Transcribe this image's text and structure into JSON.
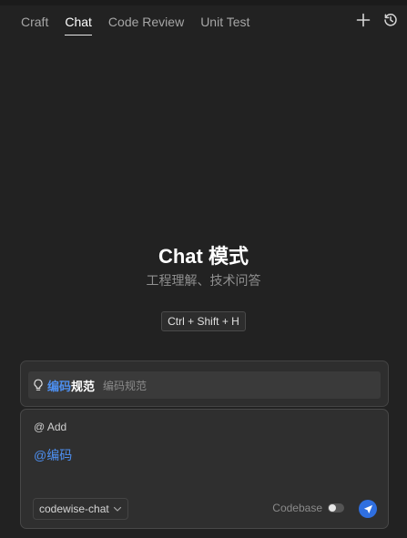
{
  "tabs": [
    {
      "label": "Craft",
      "active": false
    },
    {
      "label": "Chat",
      "active": true
    },
    {
      "label": "Code Review",
      "active": false
    },
    {
      "label": "Unit Test",
      "active": false
    }
  ],
  "header_icons": {
    "new": "plus-icon",
    "history": "history-icon"
  },
  "hero": {
    "title": "Chat 模式",
    "subtitle": "工程理解、技术问答",
    "shortcut": "Ctrl + Shift + H"
  },
  "suggestion": {
    "icon": "lightbulb-icon",
    "highlight": "编码",
    "rest": "规范",
    "description": "编码规范"
  },
  "composer": {
    "add_label": "@ Add",
    "mention_text": "@编码",
    "model": "codewise-chat",
    "codebase_label": "Codebase",
    "codebase_enabled": false
  },
  "colors": {
    "background": "#222222",
    "accent": "#4d8ff0",
    "send_button": "#2f6fe0"
  }
}
